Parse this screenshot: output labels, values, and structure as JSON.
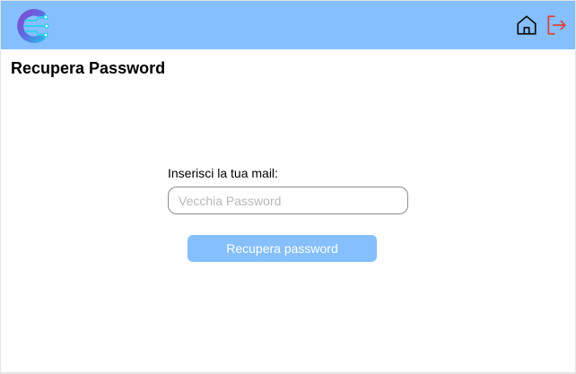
{
  "header": {
    "logo_icon": "circuit-c-logo-icon",
    "home_icon": "home-icon",
    "logout_icon": "logout-icon",
    "colors": {
      "topbar": "#85bffc",
      "home_icon": "#111111",
      "logout_icon": "#e0403a",
      "logo_gradient_start": "#8a3fd1",
      "logo_gradient_end": "#22c5e8"
    }
  },
  "page": {
    "title": "Recupera Password"
  },
  "form": {
    "email_label": "Inserisci la tua mail:",
    "email_placeholder": "Vecchia Password",
    "email_value": "",
    "submit_label": "Recupera password",
    "submit_color": "#85bffc"
  }
}
